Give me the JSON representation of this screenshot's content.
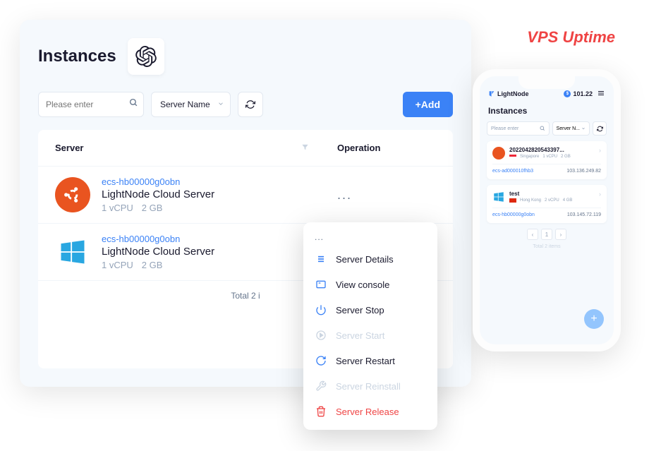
{
  "brand": "VPS Uptime",
  "page_title": "Instances",
  "search_placeholder": "Please enter",
  "filter_select": "Server Name",
  "add_button": "+Add",
  "table": {
    "col_server": "Server",
    "col_operation": "Operation",
    "rows": [
      {
        "id": "ecs-hb00000g0obn",
        "name": "LightNode Cloud Server",
        "cpu": "1 vCPU",
        "ram": "2 GB",
        "os": "ubuntu"
      },
      {
        "id": "ecs-hb00000g0obn",
        "name": "LightNode Cloud Server",
        "cpu": "1 vCPU",
        "ram": "2 GB",
        "os": "windows"
      }
    ],
    "footer_total": "Total 2 i"
  },
  "dropdown": {
    "header": "...",
    "items": [
      {
        "label": "Server Details",
        "icon": "list-icon",
        "state": "normal"
      },
      {
        "label": "View console",
        "icon": "console-icon",
        "state": "normal"
      },
      {
        "label": "Server Stop",
        "icon": "power-icon",
        "state": "normal"
      },
      {
        "label": "Server Start",
        "icon": "play-icon",
        "state": "disabled"
      },
      {
        "label": "Server Restart",
        "icon": "restart-icon",
        "state": "normal"
      },
      {
        "label": "Server Reinstall",
        "icon": "wrench-icon",
        "state": "disabled"
      },
      {
        "label": "Server Release",
        "icon": "trash-icon",
        "state": "danger"
      }
    ]
  },
  "phone": {
    "logo": "LightNode",
    "balance_icon": "$",
    "balance": "101.22",
    "title": "Instances",
    "search_placeholder": "Please enter",
    "select": "Server N...",
    "cards": [
      {
        "name": "2022042820543397...",
        "region": "Singapore",
        "cpu": "1 vCPU",
        "ram": "2 GB",
        "id": "ecs-ad000010fhb3",
        "ip": "103.136.249.82",
        "flag": "sg",
        "os": "ubuntu"
      },
      {
        "name": "test",
        "region": "Hong Kong",
        "cpu": "2 vCPU",
        "ram": "4 GB",
        "id": "ecs-hb00000g0obn",
        "ip": "103.145.72.119",
        "flag": "hk",
        "os": "windows"
      }
    ],
    "page_current": "1",
    "total": "Total 2 items"
  }
}
